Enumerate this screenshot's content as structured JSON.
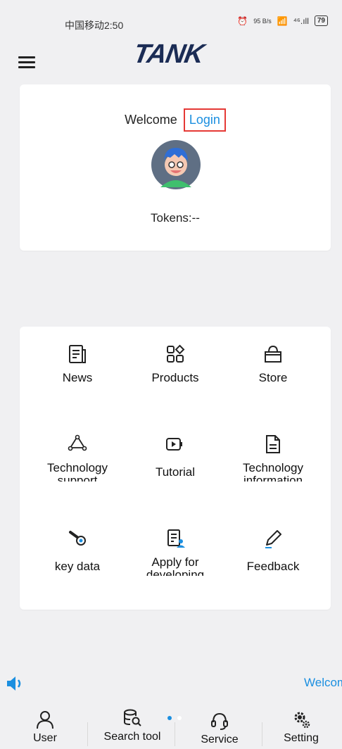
{
  "status_bar": {
    "carrier_time": "中国移动2:50",
    "net_speed": "95 B/s",
    "signal": "⁴⁶.ıll",
    "battery": "79"
  },
  "header": {
    "logo_text": "TANK"
  },
  "welcome_card": {
    "welcome_text": "Welcome",
    "login_label": "Login",
    "tokens_text": "Tokens:--"
  },
  "grid": {
    "news": "News",
    "products": "Products",
    "store": "Store",
    "tech_support": "Technology support",
    "tutorial": "Tutorial",
    "tech_info": "Technology information",
    "key_data": "key data",
    "apply_dev": "Apply for developing",
    "feedback": "Feedback"
  },
  "marquee": {
    "text": "Welcome"
  },
  "tabs": {
    "user": "User",
    "search": "Search tool",
    "service": "Service",
    "setting": "Setting"
  },
  "colors": {
    "accent": "#1b8fe0",
    "highlight_border": "#e53935",
    "logo": "#1b2c55"
  }
}
